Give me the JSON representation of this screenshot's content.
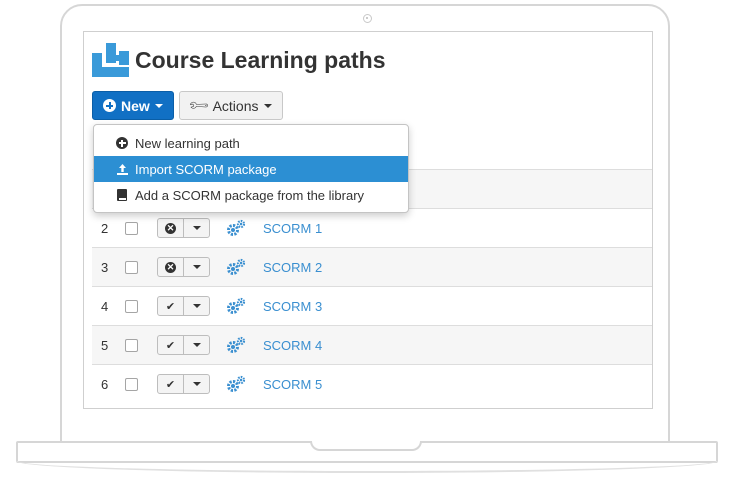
{
  "page": {
    "title": "Course Learning paths"
  },
  "toolbar": {
    "new_label": "New",
    "actions_label": "Actions"
  },
  "dropdown": {
    "items": [
      {
        "label": "New learning path",
        "icon": "plus-circle-icon"
      },
      {
        "label": "Import SCORM package",
        "icon": "upload-icon",
        "active": true
      },
      {
        "label": "Add a SCORM package from the library",
        "icon": "book-icon"
      }
    ]
  },
  "table": {
    "rows": [
      {
        "num": "",
        "status": "",
        "name": ""
      },
      {
        "num": "2",
        "status": "disabled",
        "name": "SCORM 1"
      },
      {
        "num": "3",
        "status": "disabled",
        "name": "SCORM 2"
      },
      {
        "num": "4",
        "status": "enabled",
        "name": "SCORM 3"
      },
      {
        "num": "5",
        "status": "enabled",
        "name": "SCORM 4"
      },
      {
        "num": "6",
        "status": "enabled",
        "name": "SCORM 5"
      }
    ]
  },
  "colors": {
    "primary_button": "#1170c4",
    "link": "#3a8fd0",
    "active_menu": "#2c8fd3",
    "logo": "#3a9ad9"
  }
}
